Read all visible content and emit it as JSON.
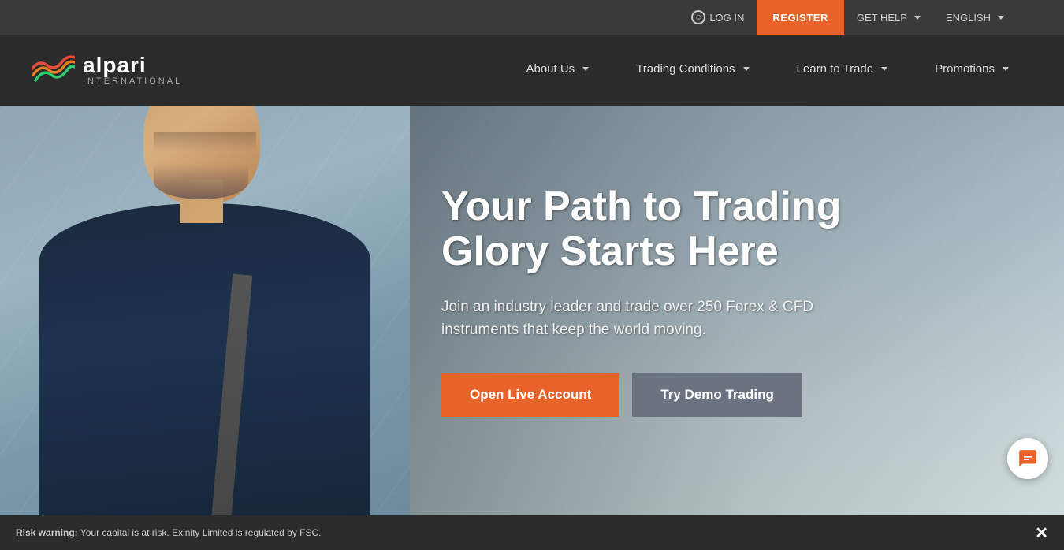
{
  "topbar": {
    "login_label": "LOG IN",
    "register_label": "REGISTER",
    "get_help_label": "GET HELP",
    "english_label": "ENGLISH"
  },
  "nav": {
    "logo_text": "alpari",
    "logo_sub": "International",
    "links": [
      {
        "id": "about-us",
        "label": "About Us"
      },
      {
        "id": "trading-conditions",
        "label": "Trading Conditions"
      },
      {
        "id": "learn-to-trade",
        "label": "Learn to Trade"
      },
      {
        "id": "promotions",
        "label": "Promotions"
      }
    ]
  },
  "hero": {
    "title": "Your Path to Trading Glory Starts Here",
    "subtitle": "Join an industry leader and trade over 250 Forex & CFD instruments that keep the world moving.",
    "btn_live": "Open Live Account",
    "btn_demo": "Try Demo Trading"
  },
  "risk": {
    "warning_label": "Risk warning:",
    "warning_text": " Your capital is at risk. Exinity Limited is regulated by FSC."
  }
}
